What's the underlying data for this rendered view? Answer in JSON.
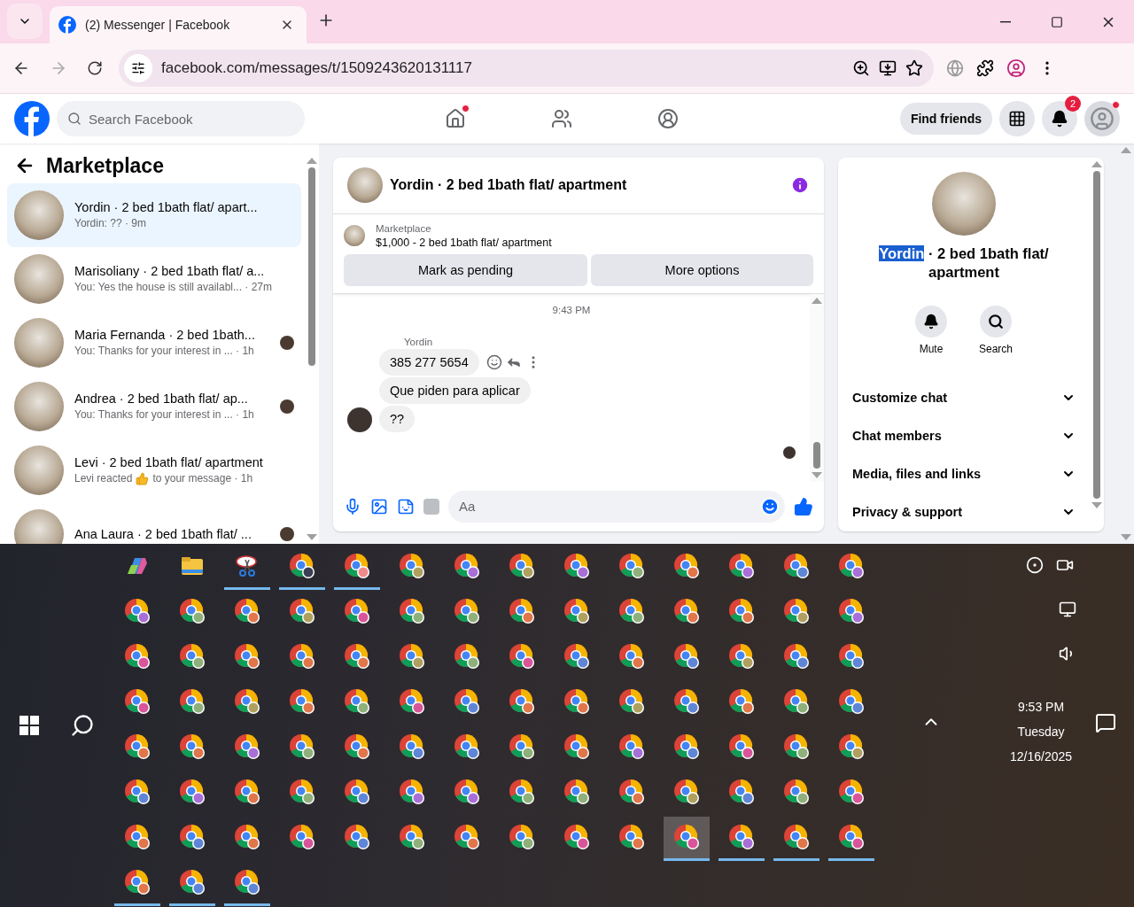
{
  "browser": {
    "tab_title": "(2) Messenger | Facebook",
    "url": "facebook.com/messages/t/1509243620131117"
  },
  "header": {
    "search_placeholder": "Search Facebook",
    "nav": [
      {
        "kind": "home",
        "notify": true
      },
      {
        "kind": "friends",
        "notify": false
      },
      {
        "kind": "groups",
        "notify": false
      }
    ],
    "find_friends": "Find friends",
    "notification_count": "2",
    "profile_notify": true
  },
  "sidebar": {
    "title": "Marketplace",
    "conversations": [
      {
        "kind": "text",
        "name": "Yordin · 2 bed 1bath flat/ apart...",
        "preview": "Yordin: ?? · 9m",
        "selected": true,
        "seen": false
      },
      {
        "kind": "text",
        "name": "Marisoliany · 2 bed 1bath flat/ a...",
        "preview": "You: Yes the house is still availabl... · 27m",
        "selected": false,
        "seen": false
      },
      {
        "kind": "text",
        "name": "Maria Fernanda · 2 bed 1bath...",
        "preview": "You: Thanks for your interest in ... · 1h",
        "selected": false,
        "seen": true
      },
      {
        "kind": "text",
        "name": "Andrea · 2 bed 1bath flat/ ap...",
        "preview": "You: Thanks for your interest in ... · 1h",
        "selected": false,
        "seen": true
      },
      {
        "kind": "reaction",
        "name": "Levi · 2 bed 1bath flat/ apartment",
        "preview": "Levi reacted",
        "preview_after": "to your message · 1h",
        "selected": false,
        "seen": false
      },
      {
        "kind": "text",
        "name": "Ana Laura · 2 bed 1bath flat/ ...",
        "selected": false,
        "seen": true
      }
    ]
  },
  "chat": {
    "title": "Yordin · 2 bed 1bath flat/ apartment",
    "listing_label": "Marketplace",
    "listing": "$1,000 - 2 bed 1bath flat/ apartment",
    "buttons": [
      "Mark as pending",
      "More options"
    ],
    "time": "9:43 PM",
    "sender": "Yordin",
    "messages": [
      {
        "text": "385 277 5654",
        "hovered": true
      },
      {
        "text": "Que  piden para aplicar",
        "hovered": false
      },
      {
        "text": "??",
        "hovered": false
      }
    ],
    "composer_placeholder": "Aa"
  },
  "details": {
    "name_selected": "Yordin",
    "name_rest": "· 2 bed 1bath flat/ apartment",
    "actions": [
      {
        "kind": "mute",
        "label": "Mute"
      },
      {
        "kind": "search",
        "label": "Search"
      }
    ],
    "sections": [
      {
        "label": "Customize chat",
        "expanded": false
      },
      {
        "label": "Chat members",
        "expanded": false
      },
      {
        "label": "Media, files and links",
        "expanded": false
      },
      {
        "label": "Privacy & support",
        "expanded": false
      }
    ]
  },
  "taskbar": {
    "time": "9:53 PM",
    "day": "Tuesday",
    "date": "12/16/2025",
    "apps": [
      {
        "kind": "copilot",
        "running": false,
        "selected": false
      },
      {
        "kind": "explorer",
        "running": false,
        "selected": false
      },
      {
        "kind": "snip",
        "running": true,
        "selected": false
      },
      {
        "kind": "chrome",
        "color": "#3a3f55",
        "running": true,
        "selected": false
      },
      {
        "kind": "chrome",
        "color": "#f08a8a",
        "running": true,
        "selected": false
      },
      {
        "kind": "chrome",
        "color": "#b0a060",
        "running": false,
        "selected": false
      },
      {
        "kind": "chrome",
        "color": "#a86fd8",
        "running": false,
        "selected": false
      },
      {
        "kind": "chrome",
        "color": "#b0a060",
        "running": false,
        "selected": false
      },
      {
        "kind": "chrome",
        "color": "#a86fd8",
        "running": false,
        "selected": false
      },
      {
        "kind": "chrome",
        "color": "#8fb07a",
        "running": false,
        "selected": false
      },
      {
        "kind": "chrome",
        "color": "#e0764a",
        "running": false,
        "selected": false
      },
      {
        "kind": "chrome",
        "color": "#a86fd8",
        "running": false,
        "selected": false
      },
      {
        "kind": "chrome",
        "color": "#5f86d6",
        "running": false,
        "selected": false
      },
      {
        "kind": "chrome",
        "color": "#a86fd8",
        "running": false,
        "selected": false
      },
      {
        "kind": "chrome",
        "color": "#a86fd8",
        "running": false,
        "selected": false
      },
      {
        "kind": "chrome",
        "color": "#8fb07a",
        "running": false,
        "selected": false
      },
      {
        "kind": "chrome",
        "color": "#e0764a",
        "running": false,
        "selected": false
      },
      {
        "kind": "chrome",
        "color": "#b0a060",
        "running": false,
        "selected": false
      },
      {
        "kind": "chrome",
        "color": "#d9559a",
        "running": false,
        "selected": false
      },
      {
        "kind": "chrome",
        "color": "#8fb07a",
        "running": false,
        "selected": false
      },
      {
        "kind": "chrome",
        "color": "#8fb07a",
        "running": false,
        "selected": false
      },
      {
        "kind": "chrome",
        "color": "#e0764a",
        "running": false,
        "selected": false
      },
      {
        "kind": "chrome",
        "color": "#b0a060",
        "running": false,
        "selected": false
      },
      {
        "kind": "chrome",
        "color": "#8fb07a",
        "running": false,
        "selected": false
      },
      {
        "kind": "chrome",
        "color": "#e0764a",
        "running": false,
        "selected": false
      },
      {
        "kind": "chrome",
        "color": "#e0764a",
        "running": false,
        "selected": false
      },
      {
        "kind": "chrome",
        "color": "#b0a060",
        "running": false,
        "selected": false
      },
      {
        "kind": "chrome",
        "color": "#a86fd8",
        "running": false,
        "selected": false
      },
      {
        "kind": "chrome",
        "color": "#d9559a",
        "running": false,
        "selected": false
      },
      {
        "kind": "chrome",
        "color": "#8fb07a",
        "running": false,
        "selected": false
      },
      {
        "kind": "chrome",
        "color": "#e0764a",
        "running": false,
        "selected": false
      },
      {
        "kind": "chrome",
        "color": "#e0764a",
        "running": false,
        "selected": false
      },
      {
        "kind": "chrome",
        "color": "#e0764a",
        "running": false,
        "selected": false
      },
      {
        "kind": "chrome",
        "color": "#b0a060",
        "running": false,
        "selected": false
      },
      {
        "kind": "chrome",
        "color": "#8fb07a",
        "running": false,
        "selected": false
      },
      {
        "kind": "chrome",
        "color": "#d9559a",
        "running": false,
        "selected": false
      },
      {
        "kind": "chrome",
        "color": "#5f86d6",
        "running": false,
        "selected": false
      },
      {
        "kind": "chrome",
        "color": "#e0764a",
        "running": false,
        "selected": false
      },
      {
        "kind": "chrome",
        "color": "#5f86d6",
        "running": false,
        "selected": false
      },
      {
        "kind": "chrome",
        "color": "#b0a060",
        "running": false,
        "selected": false
      },
      {
        "kind": "chrome",
        "color": "#5f86d6",
        "running": false,
        "selected": false
      },
      {
        "kind": "chrome",
        "color": "#5f86d6",
        "running": false,
        "selected": false
      },
      {
        "kind": "chrome",
        "color": "#d9559a",
        "running": false,
        "selected": false
      },
      {
        "kind": "chrome",
        "color": "#8fb07a",
        "running": false,
        "selected": false
      },
      {
        "kind": "chrome",
        "color": "#b0a060",
        "running": false,
        "selected": false
      },
      {
        "kind": "chrome",
        "color": "#e0764a",
        "running": false,
        "selected": false
      },
      {
        "kind": "chrome",
        "color": "#8fb07a",
        "running": false,
        "selected": false
      },
      {
        "kind": "chrome",
        "color": "#d9559a",
        "running": false,
        "selected": false
      },
      {
        "kind": "chrome",
        "color": "#5f86d6",
        "running": false,
        "selected": false
      },
      {
        "kind": "chrome",
        "color": "#e0764a",
        "running": false,
        "selected": false
      },
      {
        "kind": "chrome",
        "color": "#e0764a",
        "running": false,
        "selected": false
      },
      {
        "kind": "chrome",
        "color": "#b0a060",
        "running": false,
        "selected": false
      },
      {
        "kind": "chrome",
        "color": "#5f86d6",
        "running": false,
        "selected": false
      },
      {
        "kind": "chrome",
        "color": "#e0764a",
        "running": false,
        "selected": false
      },
      {
        "kind": "chrome",
        "color": "#8fb07a",
        "running": false,
        "selected": false
      },
      {
        "kind": "chrome",
        "color": "#5f86d6",
        "running": false,
        "selected": false
      },
      {
        "kind": "chrome",
        "color": "#e0764a",
        "running": false,
        "selected": false
      },
      {
        "kind": "chrome",
        "color": "#e0764a",
        "running": false,
        "selected": false
      },
      {
        "kind": "chrome",
        "color": "#a86fd8",
        "running": false,
        "selected": false
      },
      {
        "kind": "chrome",
        "color": "#8fb07a",
        "running": false,
        "selected": false
      },
      {
        "kind": "chrome",
        "color": "#e0764a",
        "running": false,
        "selected": false
      },
      {
        "kind": "chrome",
        "color": "#5f86d6",
        "running": false,
        "selected": false
      },
      {
        "kind": "chrome",
        "color": "#5f86d6",
        "running": false,
        "selected": false
      },
      {
        "kind": "chrome",
        "color": "#8fb07a",
        "running": false,
        "selected": false
      },
      {
        "kind": "chrome",
        "color": "#e0764a",
        "running": false,
        "selected": false
      },
      {
        "kind": "chrome",
        "color": "#a86fd8",
        "running": false,
        "selected": false
      },
      {
        "kind": "chrome",
        "color": "#5f86d6",
        "running": false,
        "selected": false
      },
      {
        "kind": "chrome",
        "color": "#d9559a",
        "running": false,
        "selected": false
      },
      {
        "kind": "chrome",
        "color": "#8fb07a",
        "running": false,
        "selected": false
      },
      {
        "kind": "chrome",
        "color": "#b0a060",
        "running": false,
        "selected": false
      },
      {
        "kind": "chrome",
        "color": "#5f86d6",
        "running": false,
        "selected": false
      },
      {
        "kind": "chrome",
        "color": "#a86fd8",
        "running": false,
        "selected": false
      },
      {
        "kind": "chrome",
        "color": "#e0764a",
        "running": false,
        "selected": false
      },
      {
        "kind": "chrome",
        "color": "#8fb07a",
        "running": false,
        "selected": false
      },
      {
        "kind": "chrome",
        "color": "#5f86d6",
        "running": false,
        "selected": false
      },
      {
        "kind": "chrome",
        "color": "#a86fd8",
        "running": false,
        "selected": false
      },
      {
        "kind": "chrome",
        "color": "#a86fd8",
        "running": false,
        "selected": false
      },
      {
        "kind": "chrome",
        "color": "#8fb07a",
        "running": false,
        "selected": false
      },
      {
        "kind": "chrome",
        "color": "#8fb07a",
        "running": false,
        "selected": false
      },
      {
        "kind": "chrome",
        "color": "#e0764a",
        "running": false,
        "selected": false
      },
      {
        "kind": "chrome",
        "color": "#b0a060",
        "running": false,
        "selected": false
      },
      {
        "kind": "chrome",
        "color": "#5f86d6",
        "running": false,
        "selected": false
      },
      {
        "kind": "chrome",
        "color": "#8fb07a",
        "running": false,
        "selected": false
      },
      {
        "kind": "chrome",
        "color": "#d9559a",
        "running": false,
        "selected": false
      },
      {
        "kind": "chrome",
        "color": "#e0764a",
        "running": false,
        "selected": false
      },
      {
        "kind": "chrome",
        "color": "#5f86d6",
        "running": false,
        "selected": false
      },
      {
        "kind": "chrome",
        "color": "#e0764a",
        "running": false,
        "selected": false
      },
      {
        "kind": "chrome",
        "color": "#d9559a",
        "running": false,
        "selected": false
      },
      {
        "kind": "chrome",
        "color": "#5f86d6",
        "running": false,
        "selected": false
      },
      {
        "kind": "chrome",
        "color": "#8fb07a",
        "running": false,
        "selected": false
      },
      {
        "kind": "chrome",
        "color": "#e0764a",
        "running": false,
        "selected": false
      },
      {
        "kind": "chrome",
        "color": "#8fb07a",
        "running": false,
        "selected": false
      },
      {
        "kind": "chrome",
        "color": "#d9559a",
        "running": false,
        "selected": false
      },
      {
        "kind": "chrome",
        "color": "#e0764a",
        "running": false,
        "selected": false
      },
      {
        "kind": "chrome",
        "color": "#d9559a",
        "running": true,
        "selected": true
      },
      {
        "kind": "chrome",
        "color": "#a86fd8",
        "running": true,
        "selected": false
      },
      {
        "kind": "chrome",
        "color": "#e0764a",
        "running": true,
        "selected": false
      },
      {
        "kind": "chrome",
        "color": "#d9559a",
        "running": true,
        "selected": false
      },
      {
        "kind": "chrome",
        "color": "#e0764a",
        "running": true,
        "selected": false
      },
      {
        "kind": "chrome",
        "color": "#5f86d6",
        "running": true,
        "selected": false
      },
      {
        "kind": "chrome",
        "color": "#5f86d6",
        "running": true,
        "selected": false
      }
    ]
  }
}
